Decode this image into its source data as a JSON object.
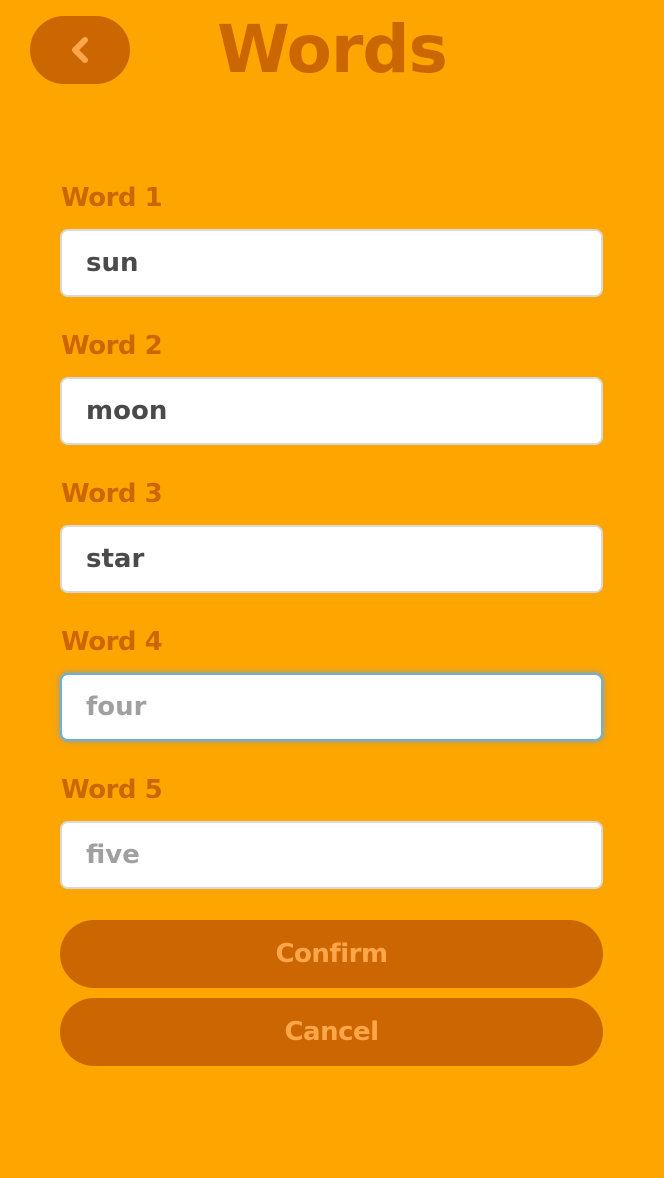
{
  "header": {
    "title": "Words",
    "back_icon": "chevron-left-icon"
  },
  "fields": [
    {
      "label": "Word 1",
      "value": "sun",
      "placeholder": ""
    },
    {
      "label": "Word 2",
      "value": "moon",
      "placeholder": ""
    },
    {
      "label": "Word 3",
      "value": "star",
      "placeholder": ""
    },
    {
      "label": "Word 4",
      "value": "",
      "placeholder": "four"
    },
    {
      "label": "Word 5",
      "value": "",
      "placeholder": "five"
    }
  ],
  "actions": {
    "confirm_label": "Confirm",
    "cancel_label": "Cancel"
  },
  "colors": {
    "background": "#FFA500",
    "accent": "#CC6600",
    "button_text": "#FFA54A",
    "focus_border": "#6AB0E0"
  }
}
